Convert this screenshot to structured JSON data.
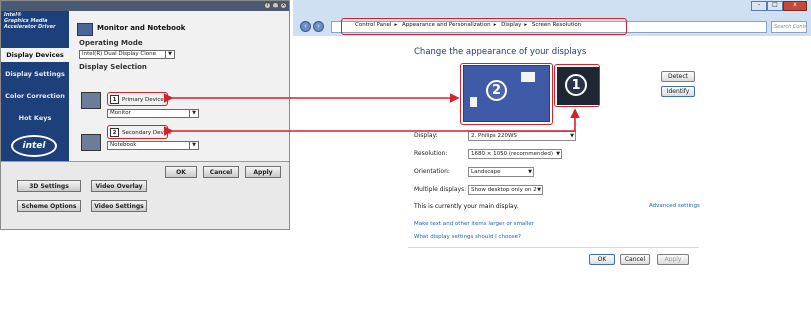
{
  "intel": {
    "brand": "Intel®\nGraphics Media\nAccelerator Driver",
    "header": "Monitor and Notebook",
    "nav": [
      "Display Devices",
      "Display Settings",
      "Color Correction",
      "Hot Keys"
    ],
    "logo": "intel",
    "operating_mode_label": "Operating Mode",
    "operating_mode_value": "Intel(R) Dual Display Clone",
    "display_selection_label": "Display Selection",
    "primary": {
      "num": "1",
      "label": "Primary Device",
      "value": "Monitor"
    },
    "secondary": {
      "num": "2",
      "label": "Secondary Device",
      "value": "Notebook"
    },
    "buttons": {
      "ok": "OK",
      "cancel": "Cancel",
      "apply": "Apply"
    },
    "bottom_buttons": [
      "3D Settings",
      "Video Overlay",
      "Scheme Options",
      "Video Settings"
    ],
    "window_buttons": [
      "?",
      "_",
      "x"
    ]
  },
  "win": {
    "caption_buttons": [
      "-",
      "□",
      "x"
    ],
    "breadcrumb": [
      "Control Panel",
      "Appearance and Personalization",
      "Display",
      "Screen Resolution"
    ],
    "search_placeholder": "Search Control Panel",
    "title": "Change the appearance of your displays",
    "monitor_2": "2",
    "monitor_1": "1",
    "detect": "Detect",
    "identify": "Identify",
    "display_label": "Display:",
    "display_value": "2. Philips 220WS",
    "resolution_label": "Resolution:",
    "resolution_value": "1680 × 1050 (recommended)",
    "orientation_label": "Orientation:",
    "orientation_value": "Landscape",
    "multiple_label": "Multiple displays:",
    "multiple_value": "Show desktop only on 2",
    "main_display_text": "This is currently your main display.",
    "advanced_link": "Advanced settings",
    "link1": "Make text and other items larger or smaller",
    "link2": "What display settings should I choose?",
    "ok": "OK",
    "cancel": "Cancel",
    "apply": "Apply"
  },
  "colors": {
    "highlight": "#d8202a",
    "intel_nav": "#1d3f7a",
    "win_chrome": "#cfe0f3",
    "link": "#1e63b5"
  }
}
